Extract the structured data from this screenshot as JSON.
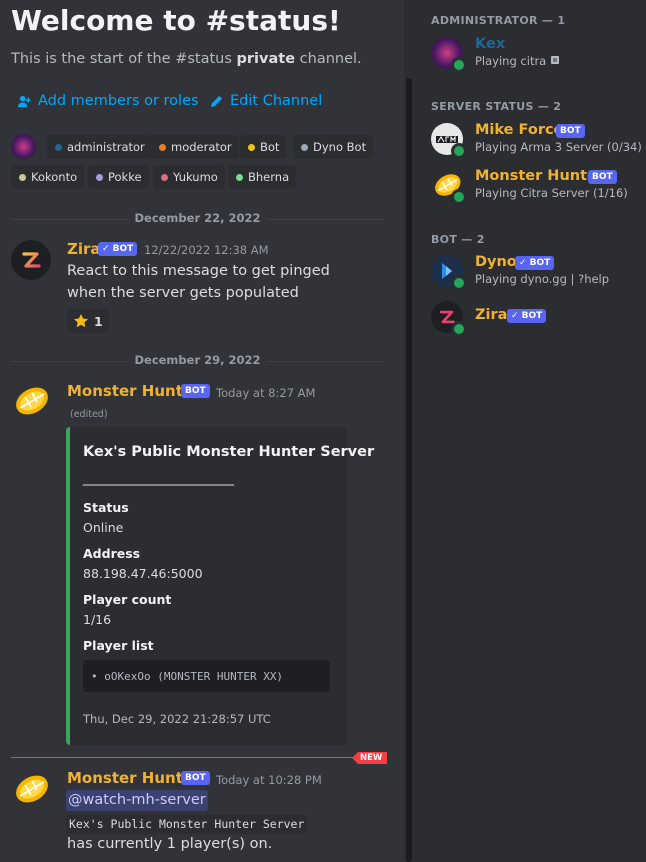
{
  "welcome": {
    "title": "Welcome to #status!",
    "sub_prefix": "This is the start of the #status ",
    "sub_bold": "private",
    "sub_suffix": " channel.",
    "add_members": "Add members or roles",
    "edit_channel": "Edit Channel"
  },
  "roles": [
    {
      "name": "administrator",
      "color": "#206694"
    },
    {
      "name": "moderator",
      "color": "#e67e22"
    },
    {
      "name": "Bot",
      "color": "#f1c40f"
    },
    {
      "name": "Dyno Bot",
      "color": "#99aab5"
    },
    {
      "name": "Kokonto",
      "color": "#c8c69a"
    },
    {
      "name": "Pokke",
      "color": "#a79dde"
    },
    {
      "name": "Yukumo",
      "color": "#e06c75"
    },
    {
      "name": "Bherna",
      "color": "#7bdc8e"
    }
  ],
  "dividers": [
    "December 22, 2022",
    "December 29, 2022"
  ],
  "msg1": {
    "author": "Zira",
    "tag": "✓ BOT",
    "timestamp": "12/22/2022 12:38 AM",
    "line1": "React to this message to get pinged",
    "line2": "when the server gets populated",
    "reaction_emoji": "star",
    "reaction_count": "1"
  },
  "msg2": {
    "author": "Monster Hunter",
    "tag": "BOT",
    "timestamp": "Today at 8:27 AM",
    "edited": "(edited)",
    "embed": {
      "title": "Kex's Public Monster Hunter Server",
      "rule": "________________________",
      "fields": [
        {
          "name": "Status",
          "value": "Online"
        },
        {
          "name": "Address",
          "value": "88.198.47.46:5000"
        },
        {
          "name": "Player count",
          "value": "1/16"
        },
        {
          "name": "Player list",
          "value": ""
        }
      ],
      "player_item": "oOKexOo (MONSTER HUNTER XX)",
      "footer": "Thu, Dec 29, 2022 21:28:57 UTC",
      "accent": "#3ba55c"
    }
  },
  "new_badge": "NEW",
  "msg3": {
    "author": "Monster Hunter",
    "tag": "BOT",
    "timestamp": "Today at 10:28 PM",
    "mention": "@watch-mh-server",
    "code": "Kex's Public Monster Hunter Server",
    "line": "has currently 1 player(s) on."
  },
  "members": {
    "groups": [
      {
        "header": "ADMINISTRATOR — 1"
      },
      {
        "header": "SERVER STATUS — 2"
      },
      {
        "header": "BOT — 2"
      }
    ],
    "kex": {
      "name": "Kex",
      "activity": "Playing citra",
      "color": "#206694"
    },
    "mikeforce": {
      "name": "Mike Force",
      "tag": "BOT",
      "activity": "Playing Arma 3 Server (0/34)",
      "color": "#f0b232"
    },
    "monsterhunter": {
      "name": "Monster Hunter",
      "tag": "BOT",
      "activity": "Playing Citra Server (1/16)",
      "color": "#f0b232"
    },
    "dyno": {
      "name": "Dyno",
      "tag": "✓ BOT",
      "activity": "Playing dyno.gg | ?help",
      "color": "#f0b232"
    },
    "zira": {
      "name": "Zira",
      "tag": "✓ BOT",
      "color": "#f0b232"
    }
  }
}
